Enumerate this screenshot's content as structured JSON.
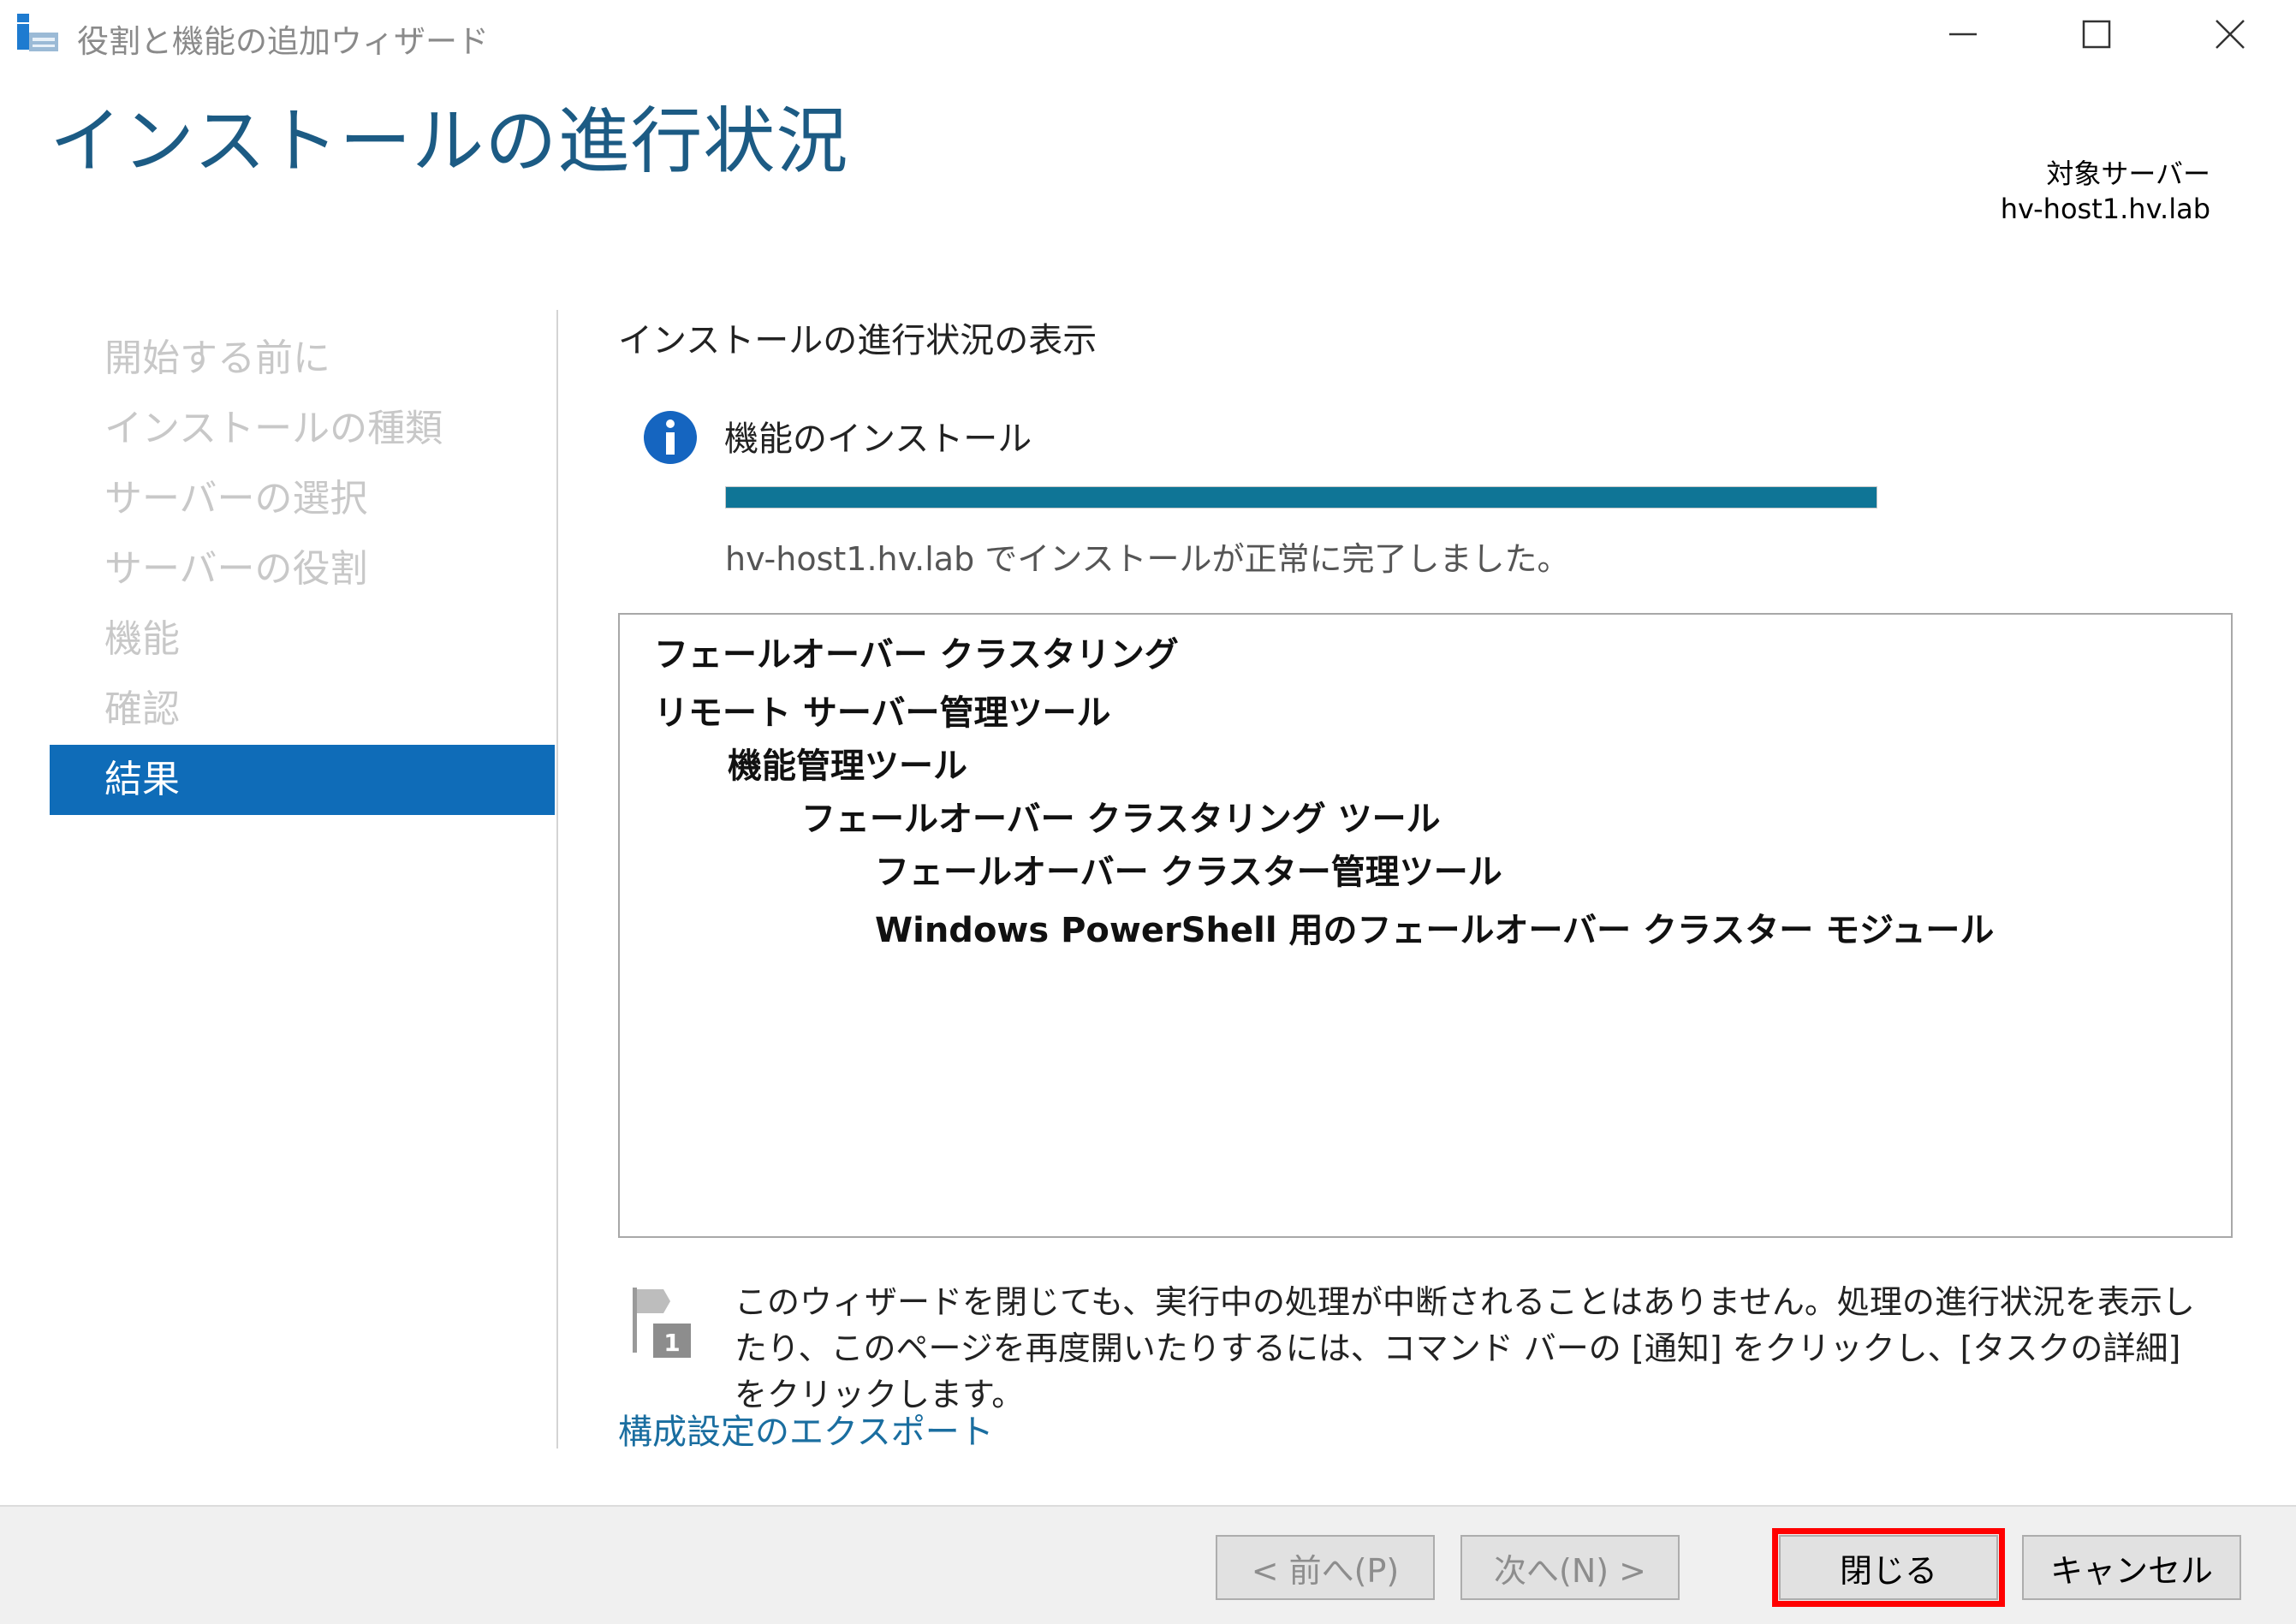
{
  "window": {
    "title": "役割と機能の追加ウィザード",
    "controls": {
      "minimize_icon": "minimize-icon",
      "maximize_icon": "maximize-icon",
      "close_icon": "close-icon"
    }
  },
  "header": {
    "page_title": "インストールの進行状況",
    "target_label": "対象サーバー",
    "target_server": "hv-host1.hv.lab"
  },
  "nav": {
    "items": [
      {
        "label": "開始する前に",
        "active": false
      },
      {
        "label": "インストールの種類",
        "active": false
      },
      {
        "label": "サーバーの選択",
        "active": false
      },
      {
        "label": "サーバーの役割",
        "active": false
      },
      {
        "label": "機能",
        "active": false
      },
      {
        "label": "確認",
        "active": false
      },
      {
        "label": "結果",
        "active": true
      }
    ]
  },
  "content": {
    "section_heading": "インストールの進行状況の表示",
    "install_label": "機能のインストール",
    "progress_percent": 100,
    "status_text": "hv-host1.hv.lab でインストールが正常に完了しました。",
    "results": [
      {
        "label": "フェールオーバー クラスタリング",
        "level": 0
      },
      {
        "label": "リモート サーバー管理ツール",
        "level": 0
      },
      {
        "label": "機能管理ツール",
        "level": 1
      },
      {
        "label": "フェールオーバー クラスタリング ツール",
        "level": 2
      },
      {
        "label": "フェールオーバー クラスター管理ツール",
        "level": 3
      },
      {
        "label": "Windows PowerShell 用のフェールオーバー クラスター モジュール",
        "level": 3
      }
    ],
    "note_icon_badge": "1",
    "note_text": "このウィザードを閉じても、実行中の処理が中断されることはありません。処理の進行状況を表示したり、このページを再度開いたりするには、コマンド バーの [通知] をクリックし、[タスクの詳細] をクリックします。",
    "export_link": "構成設定のエクスポート"
  },
  "footer": {
    "prev_label": "< 前へ(P)",
    "next_label": "次へ(N) >",
    "close_label": "閉じる",
    "cancel_label": "キャンセル"
  },
  "colors": {
    "accent": "#0f6cb8",
    "title": "#1c5b84",
    "progress": "#0f7596",
    "link": "#1a6ea0",
    "highlight": "#ff0000"
  }
}
